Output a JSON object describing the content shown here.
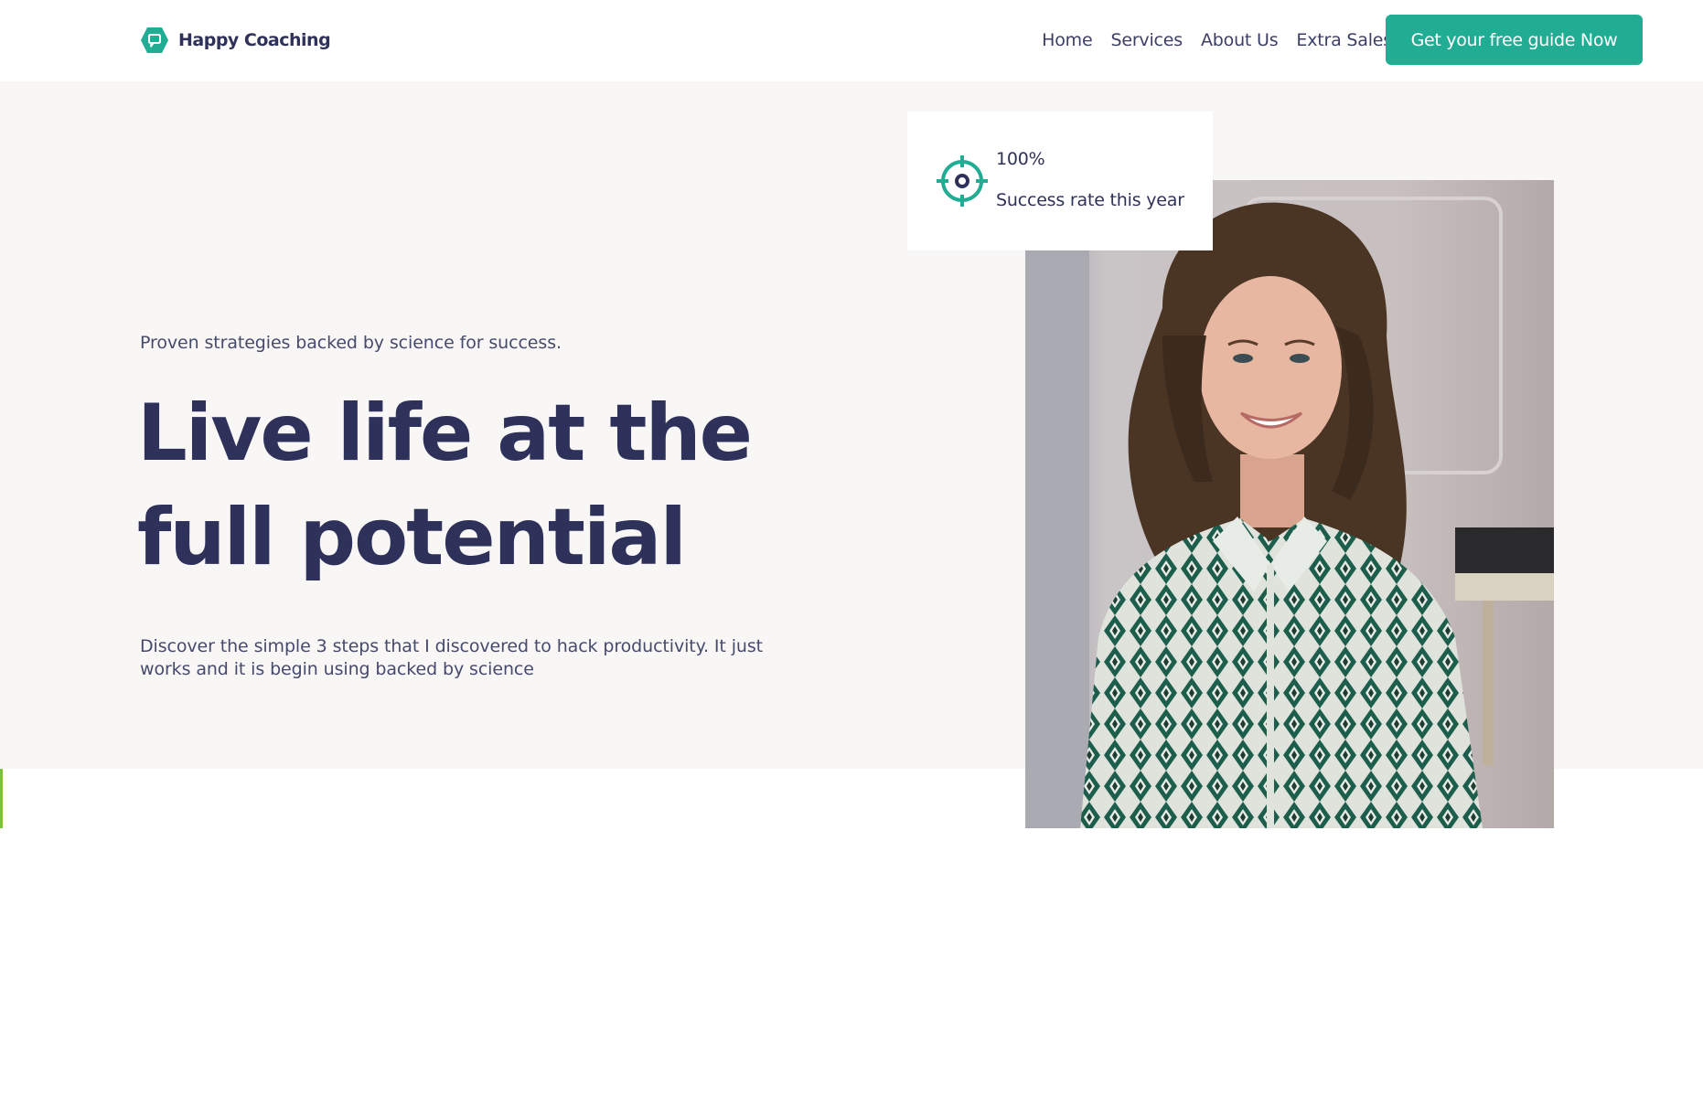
{
  "brand": {
    "name": "Happy Coaching",
    "logo_icon": "chat-bubble-hexagon-icon",
    "accent_color": "#20ad93"
  },
  "nav": {
    "items": [
      {
        "label": "Home"
      },
      {
        "label": "Services"
      },
      {
        "label": "About Us"
      },
      {
        "label": "Extra Sales"
      }
    ],
    "cta_label": "Get your free guide Now"
  },
  "hero": {
    "eyebrow": "Proven strategies backed by science for success.",
    "headline": "Live life at the full potential",
    "description": "Discover the simple 3 steps that I discovered to hack productivity. It just works and it is begin using backed by science",
    "photo": "smiling-woman-portrait",
    "stat": {
      "icon": "target-icon",
      "value": "100%",
      "label": "Success rate this year"
    }
  },
  "colors": {
    "heading": "#2e3159",
    "accent": "#20ad93",
    "hero_background": "#f8f7f6",
    "edge_stripe": "#7cc33a"
  }
}
